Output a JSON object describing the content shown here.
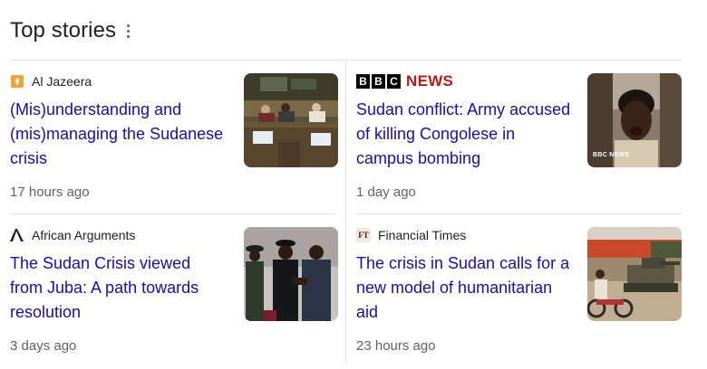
{
  "header": {
    "title": "Top stories"
  },
  "stories": [
    {
      "source": "Al Jazeera",
      "title": "(Mis)understanding and (mis)managing the Sudanese crisis",
      "time": "17 hours ago",
      "thumb_icon": "conference-table-photo"
    },
    {
      "source_logo_letters": [
        "B",
        "B",
        "C"
      ],
      "source_logo_word": "NEWS",
      "title": "Sudan conflict: Army accused of killing Congolese in campus bombing",
      "time": "1 day ago",
      "thumb_icon": "crying-woman-photo",
      "thumb_watermark": "BBC NEWS"
    },
    {
      "source": "African Arguments",
      "title": "The Sudan Crisis viewed from Juba: A path towards resolution",
      "time": "3 days ago",
      "thumb_icon": "leaders-handshake-photo"
    },
    {
      "source": "Financial Times",
      "source_icon_text": "FT",
      "title": "The crisis in Sudan calls for a new model of humanitarian aid",
      "time": "23 hours ago",
      "thumb_icon": "tank-street-photo"
    }
  ],
  "colors": {
    "link": "#1a0dab",
    "muted": "#5f6368",
    "bbc_red": "#bb1919",
    "aljazeera_orange": "#f2a33a",
    "ft_pink": "#fce8d8"
  }
}
